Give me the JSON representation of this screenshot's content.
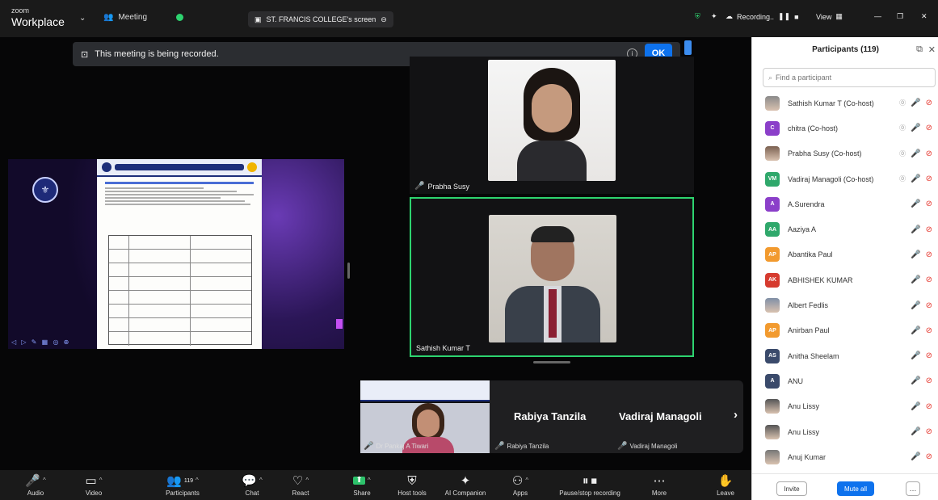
{
  "titlebar": {
    "brand_top": "zoom",
    "brand_bottom": "Workplace",
    "meeting_label": "Meeting",
    "share_tab": "ST. FRANCIS COLLEGE's screen",
    "recording_label": "Recording..",
    "view_label": "View"
  },
  "banner": {
    "text": "This meeting is being recorded.",
    "ok": "OK"
  },
  "videos": {
    "top_name": "Prabha Susy",
    "main_name": "Sathish Kumar T",
    "strip": {
      "thumb_name": "Dr Pankaj A Tiwari",
      "tile2_big": "Rabiya Tanzila",
      "tile2_small": "Rabiya Tanzila",
      "tile3_big": "Vadiraj Managoli",
      "tile3_small": "Vadiraj Managoli",
      "next": "›"
    }
  },
  "toolbar": [
    {
      "label": "Audio",
      "icon": "🎤"
    },
    {
      "label": "Video",
      "icon": "▭"
    },
    {
      "label": "Participants",
      "icon": "👥",
      "count": "119"
    },
    {
      "label": "Chat",
      "icon": "💬"
    },
    {
      "label": "React",
      "icon": "♡"
    },
    {
      "label": "Share",
      "icon": "⬆"
    },
    {
      "label": "Host tools",
      "icon": "⛨"
    },
    {
      "label": "AI Companion",
      "icon": "✦"
    },
    {
      "label": "Apps",
      "icon": "⚇"
    },
    {
      "label": "Pause/stop recording",
      "icon": "⏸"
    },
    {
      "label": "More",
      "icon": "⋯"
    },
    {
      "label": "Leave",
      "icon": "✋"
    }
  ],
  "panel": {
    "title": "Participants (119)",
    "search_placeholder": "Find a participant",
    "invite": "Invite",
    "mute_all": "Mute all",
    "more": "…",
    "participants": [
      {
        "name": "Sathish Kumar T (Co-host)",
        "initials": "",
        "color": "#8a8a8a",
        "photo": true
      },
      {
        "name": "chitra (Co-host)",
        "initials": "C",
        "color": "#8b3fc9"
      },
      {
        "name": "Prabha Susy (Co-host)",
        "initials": "",
        "color": "#7a6050",
        "photo": true
      },
      {
        "name": "Vadiraj Managoli (Co-host)",
        "initials": "VM",
        "color": "#2fa86b"
      },
      {
        "name": "A.Surendra",
        "initials": "A",
        "color": "#8b3fc9"
      },
      {
        "name": "Aaziya A",
        "initials": "AA",
        "color": "#2fa86b"
      },
      {
        "name": "Abantika Paul",
        "initials": "AP",
        "color": "#f29a2e"
      },
      {
        "name": "ABHISHEK KUMAR",
        "initials": "AK",
        "color": "#d63b2f"
      },
      {
        "name": "Albert Fedlis",
        "initials": "",
        "color": "#7f8fa6",
        "photo": true
      },
      {
        "name": "Anirban Paul",
        "initials": "AP",
        "color": "#f29a2e"
      },
      {
        "name": "Anitha Sheelam",
        "initials": "AS",
        "color": "#3a4a6b"
      },
      {
        "name": "ANU",
        "initials": "A",
        "color": "#3a4a6b"
      },
      {
        "name": "Anu Lissy",
        "initials": "",
        "color": "#555",
        "photo": true
      },
      {
        "name": "Anu Lissy",
        "initials": "",
        "color": "#555",
        "photo": true
      },
      {
        "name": "Anuj Kumar",
        "initials": "",
        "color": "#777",
        "photo": true
      }
    ]
  }
}
